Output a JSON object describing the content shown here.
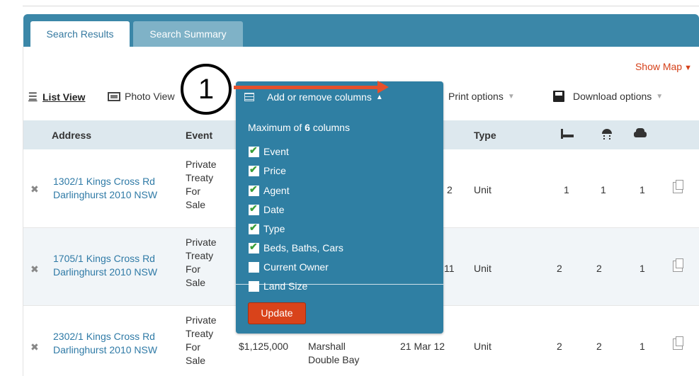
{
  "tabs": [
    {
      "label": "Search Results",
      "active": true
    },
    {
      "label": "Search Summary",
      "active": false
    }
  ],
  "show_map": {
    "label": "Show Map",
    "arrow": "▼"
  },
  "toolbar": {
    "list_view": "List View",
    "photo_view": "Photo View",
    "add_remove_columns": "Add or remove columns",
    "print_options": "Print options",
    "download_options": "Download options"
  },
  "table": {
    "headers": {
      "address": "Address",
      "event": "Event",
      "type": "Type"
    },
    "rows": [
      {
        "addr1": "1302/1 Kings Cross Rd",
        "addr2": "Darlinghurst 2010 NSW",
        "event": [
          "Private",
          "Treaty",
          "For",
          "Sale"
        ],
        "date_fragment": "2",
        "price": "",
        "agent": [],
        "date": "",
        "type": "Unit",
        "beds": "1",
        "baths": "1",
        "cars": "1"
      },
      {
        "addr1": "1705/1 Kings Cross Rd",
        "addr2": "Darlinghurst 2010 NSW",
        "event": [
          "Private",
          "Treaty",
          "For",
          "Sale"
        ],
        "date_fragment": "11",
        "price": "",
        "agent": [],
        "date": "",
        "type": "Unit",
        "beds": "2",
        "baths": "2",
        "cars": "1"
      },
      {
        "addr1": "2302/1 Kings Cross Rd",
        "addr2": "Darlinghurst 2010 NSW",
        "event": [
          "Private",
          "Treaty",
          "For",
          "Sale"
        ],
        "date_fragment": "",
        "price": "$1,125,000",
        "agent": [
          "Marshall",
          "Double Bay"
        ],
        "date": "21 Mar 12",
        "type": "Unit",
        "beds": "2",
        "baths": "2",
        "cars": "1"
      }
    ]
  },
  "columns_dropdown": {
    "max_prefix": "Maximum of",
    "max_value": "6",
    "max_suffix": "columns",
    "options": [
      {
        "label": "Event",
        "checked": true
      },
      {
        "label": "Price",
        "checked": true
      },
      {
        "label": "Agent",
        "checked": true
      },
      {
        "label": "Date",
        "checked": true
      },
      {
        "label": "Type",
        "checked": true
      },
      {
        "label": "Beds, Baths, Cars",
        "checked": true
      },
      {
        "label": "Current Owner",
        "checked": false
      },
      {
        "label": "Land Size",
        "checked": false
      }
    ],
    "update_label": "Update"
  },
  "callout": {
    "number": "1"
  },
  "colors": {
    "accent": "#3b87a8",
    "dropdown": "#2f7fa3",
    "update_button": "#d9431a",
    "link": "#2f7aa6",
    "arrow": "#e5502b"
  }
}
